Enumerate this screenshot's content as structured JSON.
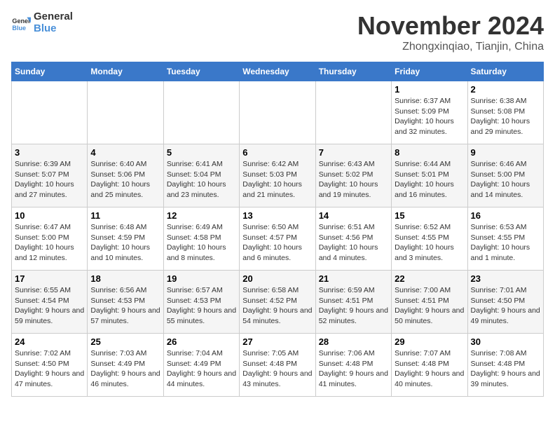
{
  "logo": {
    "line1": "General",
    "line2": "Blue"
  },
  "title": "November 2024",
  "location": "Zhongxinqiao, Tianjin, China",
  "weekdays": [
    "Sunday",
    "Monday",
    "Tuesday",
    "Wednesday",
    "Thursday",
    "Friday",
    "Saturday"
  ],
  "weeks": [
    [
      {
        "day": "",
        "info": ""
      },
      {
        "day": "",
        "info": ""
      },
      {
        "day": "",
        "info": ""
      },
      {
        "day": "",
        "info": ""
      },
      {
        "day": "",
        "info": ""
      },
      {
        "day": "1",
        "info": "Sunrise: 6:37 AM\nSunset: 5:09 PM\nDaylight: 10 hours and 32 minutes."
      },
      {
        "day": "2",
        "info": "Sunrise: 6:38 AM\nSunset: 5:08 PM\nDaylight: 10 hours and 29 minutes."
      }
    ],
    [
      {
        "day": "3",
        "info": "Sunrise: 6:39 AM\nSunset: 5:07 PM\nDaylight: 10 hours and 27 minutes."
      },
      {
        "day": "4",
        "info": "Sunrise: 6:40 AM\nSunset: 5:06 PM\nDaylight: 10 hours and 25 minutes."
      },
      {
        "day": "5",
        "info": "Sunrise: 6:41 AM\nSunset: 5:04 PM\nDaylight: 10 hours and 23 minutes."
      },
      {
        "day": "6",
        "info": "Sunrise: 6:42 AM\nSunset: 5:03 PM\nDaylight: 10 hours and 21 minutes."
      },
      {
        "day": "7",
        "info": "Sunrise: 6:43 AM\nSunset: 5:02 PM\nDaylight: 10 hours and 19 minutes."
      },
      {
        "day": "8",
        "info": "Sunrise: 6:44 AM\nSunset: 5:01 PM\nDaylight: 10 hours and 16 minutes."
      },
      {
        "day": "9",
        "info": "Sunrise: 6:46 AM\nSunset: 5:00 PM\nDaylight: 10 hours and 14 minutes."
      }
    ],
    [
      {
        "day": "10",
        "info": "Sunrise: 6:47 AM\nSunset: 5:00 PM\nDaylight: 10 hours and 12 minutes."
      },
      {
        "day": "11",
        "info": "Sunrise: 6:48 AM\nSunset: 4:59 PM\nDaylight: 10 hours and 10 minutes."
      },
      {
        "day": "12",
        "info": "Sunrise: 6:49 AM\nSunset: 4:58 PM\nDaylight: 10 hours and 8 minutes."
      },
      {
        "day": "13",
        "info": "Sunrise: 6:50 AM\nSunset: 4:57 PM\nDaylight: 10 hours and 6 minutes."
      },
      {
        "day": "14",
        "info": "Sunrise: 6:51 AM\nSunset: 4:56 PM\nDaylight: 10 hours and 4 minutes."
      },
      {
        "day": "15",
        "info": "Sunrise: 6:52 AM\nSunset: 4:55 PM\nDaylight: 10 hours and 3 minutes."
      },
      {
        "day": "16",
        "info": "Sunrise: 6:53 AM\nSunset: 4:55 PM\nDaylight: 10 hours and 1 minute."
      }
    ],
    [
      {
        "day": "17",
        "info": "Sunrise: 6:55 AM\nSunset: 4:54 PM\nDaylight: 9 hours and 59 minutes."
      },
      {
        "day": "18",
        "info": "Sunrise: 6:56 AM\nSunset: 4:53 PM\nDaylight: 9 hours and 57 minutes."
      },
      {
        "day": "19",
        "info": "Sunrise: 6:57 AM\nSunset: 4:53 PM\nDaylight: 9 hours and 55 minutes."
      },
      {
        "day": "20",
        "info": "Sunrise: 6:58 AM\nSunset: 4:52 PM\nDaylight: 9 hours and 54 minutes."
      },
      {
        "day": "21",
        "info": "Sunrise: 6:59 AM\nSunset: 4:51 PM\nDaylight: 9 hours and 52 minutes."
      },
      {
        "day": "22",
        "info": "Sunrise: 7:00 AM\nSunset: 4:51 PM\nDaylight: 9 hours and 50 minutes."
      },
      {
        "day": "23",
        "info": "Sunrise: 7:01 AM\nSunset: 4:50 PM\nDaylight: 9 hours and 49 minutes."
      }
    ],
    [
      {
        "day": "24",
        "info": "Sunrise: 7:02 AM\nSunset: 4:50 PM\nDaylight: 9 hours and 47 minutes."
      },
      {
        "day": "25",
        "info": "Sunrise: 7:03 AM\nSunset: 4:49 PM\nDaylight: 9 hours and 46 minutes."
      },
      {
        "day": "26",
        "info": "Sunrise: 7:04 AM\nSunset: 4:49 PM\nDaylight: 9 hours and 44 minutes."
      },
      {
        "day": "27",
        "info": "Sunrise: 7:05 AM\nSunset: 4:48 PM\nDaylight: 9 hours and 43 minutes."
      },
      {
        "day": "28",
        "info": "Sunrise: 7:06 AM\nSunset: 4:48 PM\nDaylight: 9 hours and 41 minutes."
      },
      {
        "day": "29",
        "info": "Sunrise: 7:07 AM\nSunset: 4:48 PM\nDaylight: 9 hours and 40 minutes."
      },
      {
        "day": "30",
        "info": "Sunrise: 7:08 AM\nSunset: 4:48 PM\nDaylight: 9 hours and 39 minutes."
      }
    ]
  ]
}
